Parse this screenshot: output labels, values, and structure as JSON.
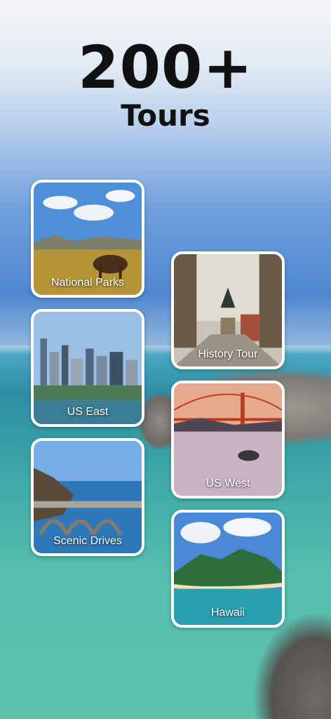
{
  "headline": {
    "count": "200+",
    "subtitle": "Tours"
  },
  "tours": [
    {
      "label": "National Parks"
    },
    {
      "label": "History Tour"
    },
    {
      "label": "US East"
    },
    {
      "label": "US West"
    },
    {
      "label": "Scenic Drives"
    },
    {
      "label": "Hawaii"
    }
  ]
}
